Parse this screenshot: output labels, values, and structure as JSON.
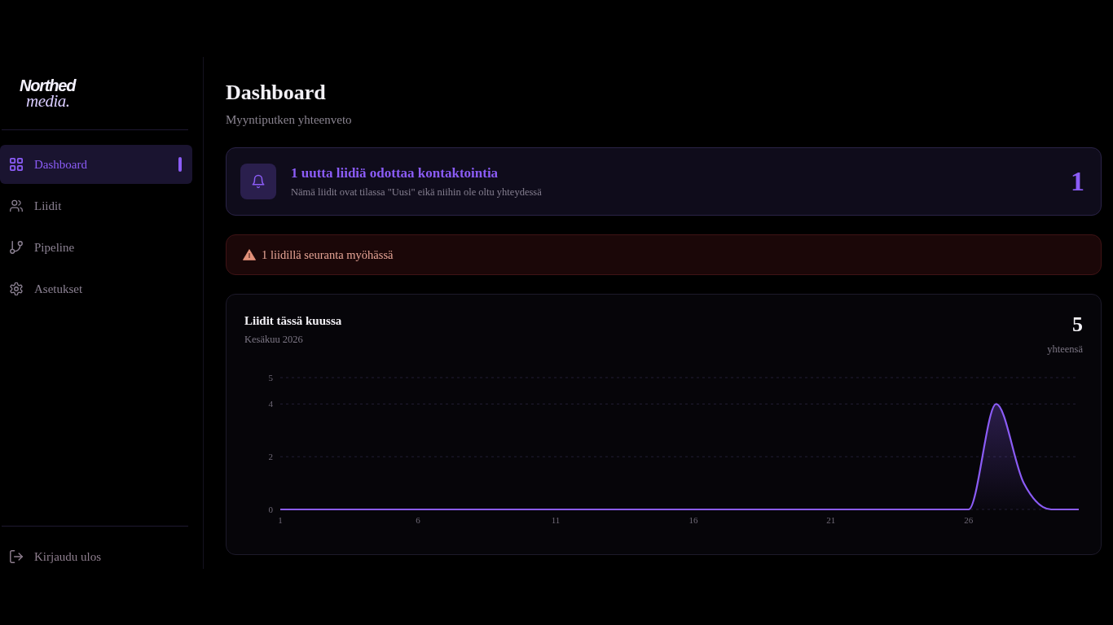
{
  "sidebar": {
    "logo": {
      "line_1": "Northed",
      "line_2": "media."
    },
    "items": [
      {
        "label": "Dashboard",
        "selected": true
      },
      {
        "label": "Liidit",
        "selected": false
      },
      {
        "label": "Pipeline",
        "selected": false
      },
      {
        "label": "Asetukset",
        "selected": false
      }
    ],
    "logout": {
      "label": "Kirjaudu ulos"
    }
  },
  "header": {
    "title": "Dashboard",
    "subtitle": "Myyntiputken yhteenveto"
  },
  "new_leads_notice": {
    "title": "1 uutta liidiä odottaa kontaktointia",
    "text": "Nämä liidit ovat tilassa \"Uusi\" eikä niihin ole oltu yhteydessä",
    "count": "1"
  },
  "overdue_alert": {
    "text": "1 liidillä seuranta myöhässä"
  },
  "leads_chart_card": {
    "title": "Liidit tässä kuussa",
    "subtitle": "Kesäkuu 2026",
    "total": "5",
    "total_label": "yhteensä",
    "chart_data": {
      "type": "area",
      "x": [
        1,
        2,
        3,
        4,
        5,
        6,
        7,
        8,
        9,
        10,
        11,
        12,
        13,
        14,
        15,
        16,
        17,
        18,
        19,
        20,
        21,
        22,
        23,
        24,
        25,
        26,
        27,
        28,
        29,
        30
      ],
      "values": [
        0,
        0,
        0,
        0,
        0,
        0,
        0,
        0,
        0,
        0,
        0,
        0,
        0,
        0,
        0,
        0,
        0,
        0,
        0,
        0,
        0,
        0,
        0,
        0,
        0,
        0,
        4,
        1,
        0,
        0
      ],
      "xlim": [
        1,
        30
      ],
      "ylim": [
        0,
        5
      ],
      "xticks": [
        1,
        6,
        11,
        16,
        21,
        26
      ],
      "yticks": [
        0,
        2,
        4,
        5
      ]
    }
  }
}
